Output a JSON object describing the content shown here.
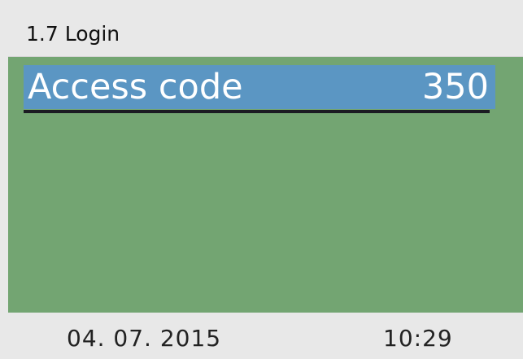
{
  "header": {
    "title": "1.7 Login"
  },
  "parameter": {
    "label": "Access code",
    "value": "350"
  },
  "footer": {
    "date": "04. 07. 2015",
    "time": "10:29"
  },
  "colors": {
    "header_bg": "#e8e8e8",
    "content_bg": "#73a572",
    "selection_bg": "#5b96c3",
    "text_dark": "#111111",
    "text_light": "#ffffff"
  }
}
